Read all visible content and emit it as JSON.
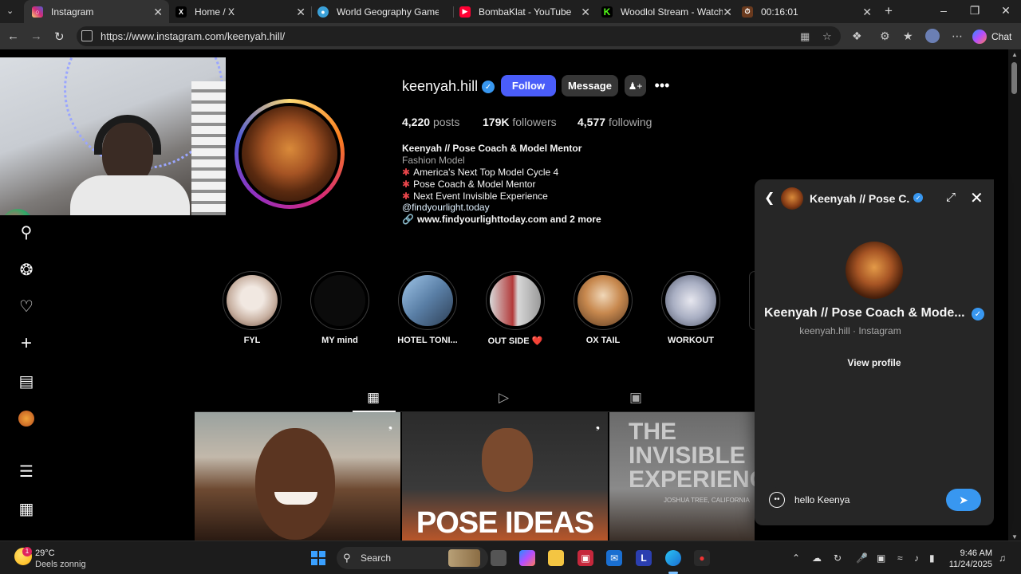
{
  "browser": {
    "tabs": [
      {
        "label": "Instagram",
        "favicon": "instagram-icon",
        "active": true
      },
      {
        "label": "Home / X",
        "favicon": "x-icon"
      },
      {
        "label": "World Geography Games On",
        "favicon": "globe-icon"
      },
      {
        "label": "BombaKlat - YouTube",
        "favicon": "youtube-icon"
      },
      {
        "label": "Woodlol Stream - Watch Live",
        "favicon": "kick-icon"
      },
      {
        "label": "00:16:01",
        "favicon": "timer-icon"
      }
    ],
    "url": "https://www.instagram.com/keenyah.hill/",
    "chat_label": "Chat"
  },
  "profile": {
    "username": "keenyah.hill",
    "follow_label": "Follow",
    "message_label": "Message",
    "stats": {
      "posts_count": "4,220",
      "posts_label": "posts",
      "followers_count": "179K",
      "followers_label": "followers",
      "following_count": "4,577",
      "following_label": "following"
    },
    "bio": {
      "name": "Keenyah // Pose Coach & Model Mentor",
      "category": "Fashion Model",
      "lines": [
        "America's Next Top Model Cycle 4",
        "Pose Coach & Model Mentor",
        "Next Event Invisible Experience"
      ],
      "mention": "@findyourlight.today",
      "link": "www.findyourlighttoday.com and 2 more"
    },
    "highlights": [
      "FYL",
      "MY mind",
      "HOTEL TONI...",
      "OUT SIDE ❤️",
      "OX TAIL",
      "WORKOUT"
    ],
    "posts": [
      {
        "caption": ""
      },
      {
        "caption": "POSE IDEAS"
      },
      {
        "caption": "THE INVISIBLE EXPERIENCE",
        "sub": "JOSHUA TREE, CALIFORNIA"
      }
    ]
  },
  "chat": {
    "header_title": "Keenyah // Pose C...",
    "display_name": "Keenyah // Pose Coach & Mode...",
    "subtitle": "keenyah.hill · Instagram",
    "view_profile_label": "View profile",
    "input_value": "hello Keenya"
  },
  "taskbar": {
    "weather_temp": "29°C",
    "weather_desc": "Deels zonnig",
    "weather_badge": "1",
    "search_label": "Search",
    "time": "9:46 AM",
    "date": "11/24/2025"
  },
  "colors": {
    "follow_blue": "#4a5df9",
    "verified_blue": "#3897f0",
    "panel_bg": "#262626"
  }
}
